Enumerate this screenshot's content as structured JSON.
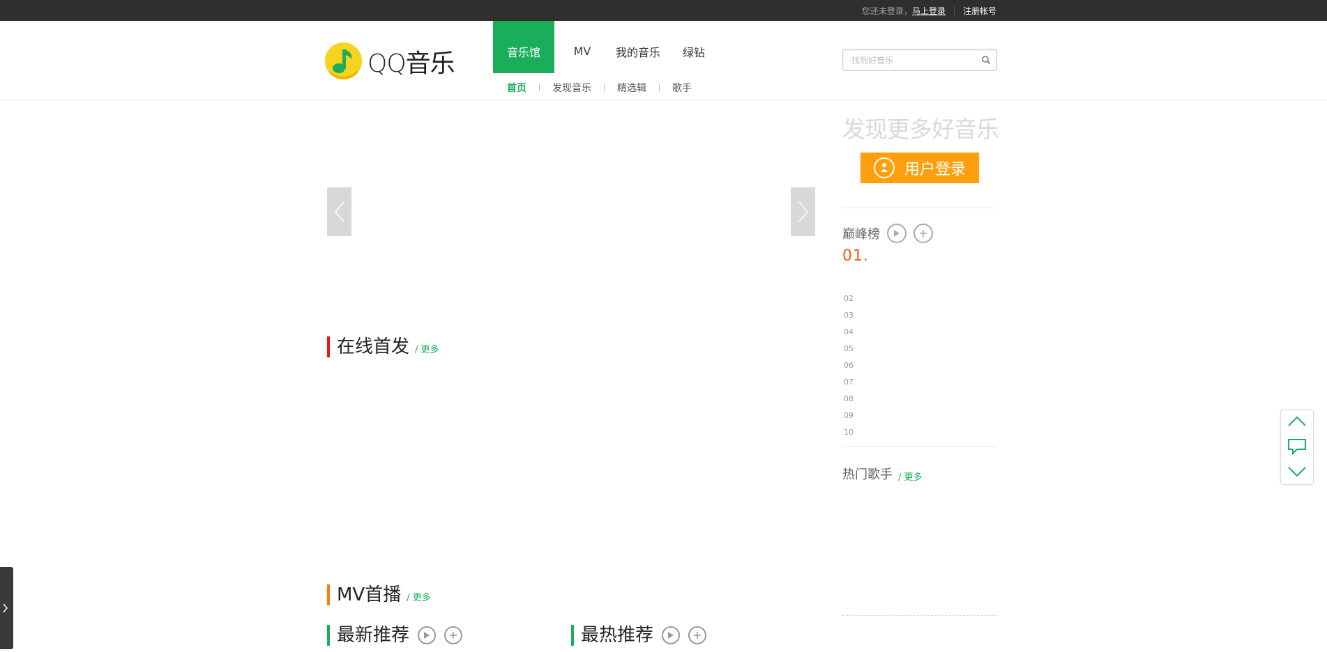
{
  "topbar": {
    "not_logged_in": "您还未登录，",
    "login_now": "马上登录",
    "register": "注册帐号"
  },
  "logo": {
    "text": "QQ音乐"
  },
  "nav": {
    "items": [
      {
        "label": "音乐馆"
      },
      {
        "label": "MV"
      },
      {
        "label": "我的音乐"
      },
      {
        "label": "绿钻"
      }
    ],
    "sub_items": [
      {
        "label": "首页"
      },
      {
        "label": "发现音乐"
      },
      {
        "label": "精选辑"
      },
      {
        "label": "歌手"
      }
    ]
  },
  "search": {
    "placeholder": "找到好音乐"
  },
  "sections": {
    "online": {
      "title": "在线首发",
      "more": "/ 更多"
    },
    "mv": {
      "title": "MV首播",
      "more": "/ 更多"
    },
    "latest": {
      "title": "最新推荐"
    },
    "hottest": {
      "title": "最热推荐"
    }
  },
  "sidebar": {
    "discover": "发现更多好音乐",
    "login_button": "用户登录",
    "peak": {
      "title": "巅峰榜",
      "first": "01.",
      "ranks": [
        "02",
        "03",
        "04",
        "05",
        "06",
        "07",
        "08",
        "09",
        "10"
      ]
    },
    "hot_singers": {
      "title": "热门歌手",
      "more": "/ 更多"
    }
  },
  "colors": {
    "brand_green": "#1aae5a",
    "login_orange": "#ff9f0d",
    "rank_orange": "#ff5a00",
    "online_bar": "#e8141e",
    "mv_bar": "#ff7e00",
    "recommend_bar": "#1aae5a"
  },
  "icons": [
    "music-note-logo-icon",
    "search-icon",
    "chevron-left-icon",
    "chevron-right-icon",
    "user-icon",
    "play-icon",
    "plus-icon",
    "chevron-up-icon",
    "feedback-icon",
    "chevron-down-icon",
    "expand-panel-icon"
  ]
}
